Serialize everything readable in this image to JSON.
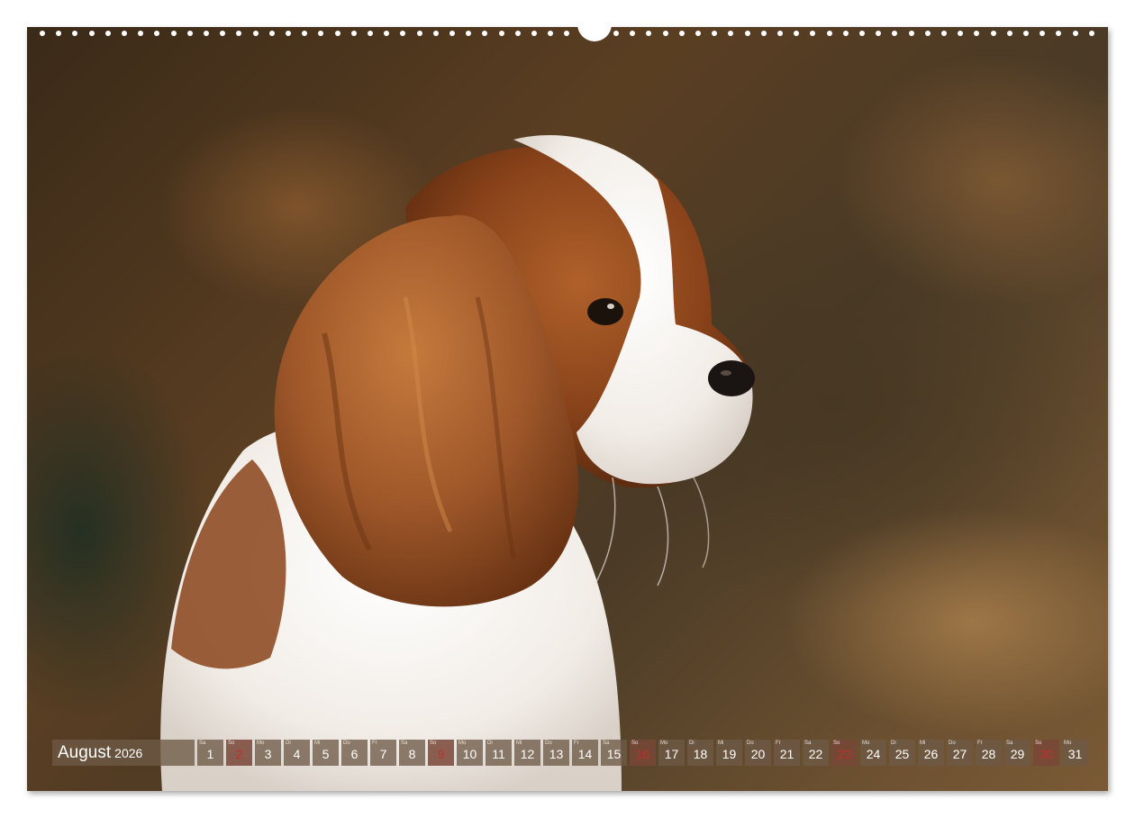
{
  "calendar": {
    "month": "August",
    "year": "2026",
    "days": [
      {
        "dow": "Sa",
        "num": "1",
        "sunday": false
      },
      {
        "dow": "So",
        "num": "2",
        "sunday": true
      },
      {
        "dow": "Mo",
        "num": "3",
        "sunday": false
      },
      {
        "dow": "Di",
        "num": "4",
        "sunday": false
      },
      {
        "dow": "Mi",
        "num": "5",
        "sunday": false
      },
      {
        "dow": "Do",
        "num": "6",
        "sunday": false
      },
      {
        "dow": "Fr",
        "num": "7",
        "sunday": false
      },
      {
        "dow": "Sa",
        "num": "8",
        "sunday": false
      },
      {
        "dow": "So",
        "num": "9",
        "sunday": true
      },
      {
        "dow": "Mo",
        "num": "10",
        "sunday": false
      },
      {
        "dow": "Di",
        "num": "11",
        "sunday": false
      },
      {
        "dow": "Mi",
        "num": "12",
        "sunday": false
      },
      {
        "dow": "Do",
        "num": "13",
        "sunday": false
      },
      {
        "dow": "Fr",
        "num": "14",
        "sunday": false
      },
      {
        "dow": "Sa",
        "num": "15",
        "sunday": false
      },
      {
        "dow": "So",
        "num": "16",
        "sunday": true
      },
      {
        "dow": "Mo",
        "num": "17",
        "sunday": false
      },
      {
        "dow": "Di",
        "num": "18",
        "sunday": false
      },
      {
        "dow": "Mi",
        "num": "19",
        "sunday": false
      },
      {
        "dow": "Do",
        "num": "20",
        "sunday": false
      },
      {
        "dow": "Fr",
        "num": "21",
        "sunday": false
      },
      {
        "dow": "Sa",
        "num": "22",
        "sunday": false
      },
      {
        "dow": "So",
        "num": "23",
        "sunday": true
      },
      {
        "dow": "Mo",
        "num": "24",
        "sunday": false
      },
      {
        "dow": "Di",
        "num": "25",
        "sunday": false
      },
      {
        "dow": "Mi",
        "num": "26",
        "sunday": false
      },
      {
        "dow": "Do",
        "num": "27",
        "sunday": false
      },
      {
        "dow": "Fr",
        "num": "28",
        "sunday": false
      },
      {
        "dow": "Sa",
        "num": "29",
        "sunday": false
      },
      {
        "dow": "So",
        "num": "30",
        "sunday": true
      },
      {
        "dow": "Mo",
        "num": "31",
        "sunday": false
      }
    ]
  },
  "colors": {
    "cell_background": "#6e5a46",
    "sunday_number": "#c0302a",
    "text": "#ffffff"
  },
  "photo": {
    "subject": "cavalier-king-charles-spaniel-puppy"
  }
}
